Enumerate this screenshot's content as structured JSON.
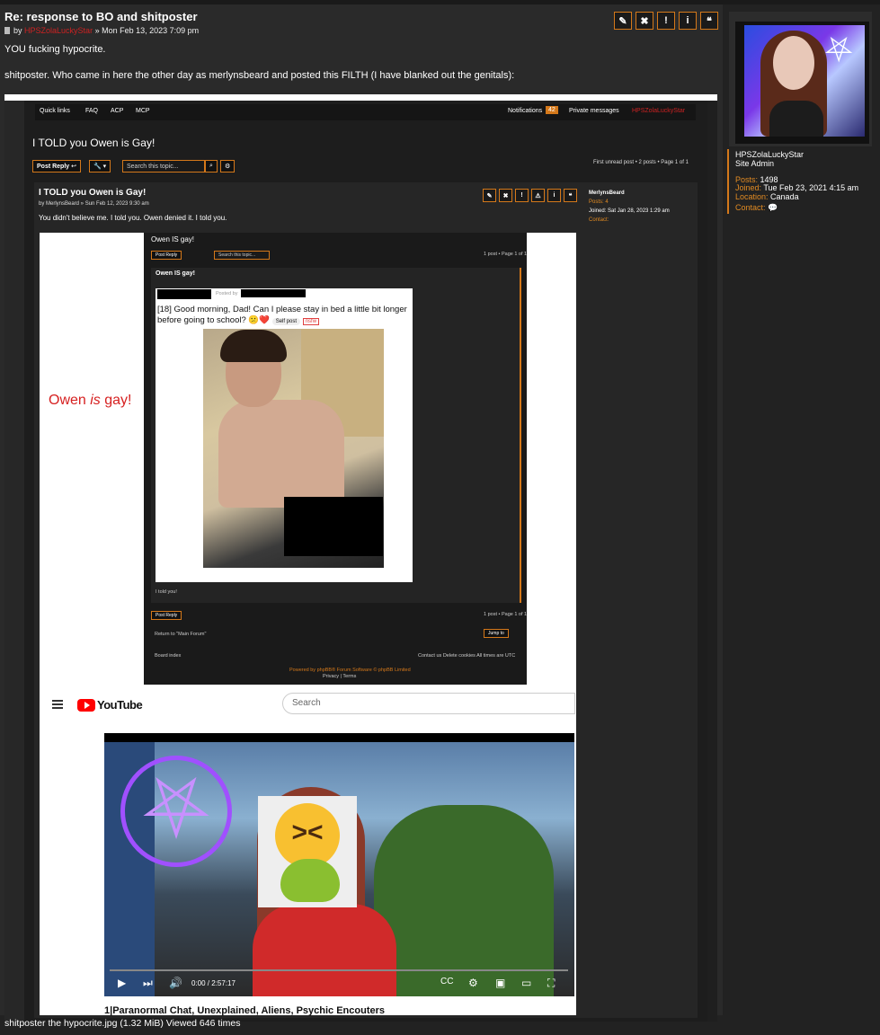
{
  "post": {
    "title": "Re: response to BO and shitposter",
    "by": "by",
    "author": "HPSZolaLuckyStar",
    "date": "» Mon Feb 13, 2023 7:09 pm",
    "line1": "YOU fucking hypocrite.",
    "line2": "shitposter. Who came in here the other day as merlynsbeard and posted this FILTH (I have blanked out the genitals):",
    "actions": [
      "✎",
      "✖",
      "!",
      "i",
      "❝"
    ]
  },
  "author_card": {
    "name": "HPSZolaLuckyStar",
    "rank": "Site Admin",
    "posts_label": "Posts:",
    "posts_value": "1498",
    "joined_label": "Joined:",
    "joined_value": "Tue Feb 23, 2021 4:15 am",
    "location_label": "Location:",
    "location_value": "Canada",
    "contact_label": "Contact:"
  },
  "attachment": {
    "quickbar": {
      "quick_links": "Quick links",
      "faq": "FAQ",
      "acp": "ACP",
      "mcp": "MCP",
      "notifications": "Notifications",
      "notif_count": "42",
      "private_messages": "Private messages",
      "user": "HPSZolaLuckyStar"
    },
    "topic_title": "I TOLD you Owen is Gay!",
    "post_reply": "Post Reply",
    "search_placeholder": "Search this topic...",
    "page_info": "First unread post • 2 posts • Page 1 of 1",
    "inner_post": {
      "title": "I TOLD you Owen is Gay!",
      "by": "by MerlynsBeard » Sun Feb 12, 2023 9:30 am",
      "body": "You didn't believe me. I told you. Owen denied it. I told you.",
      "side_name": "MerlynsBeard",
      "side_posts": "Posts: 4",
      "side_joined": "Joined: Sat Jan 28, 2023 1:29 am",
      "side_contact": "Contact:"
    },
    "owen_prefix": "Owen ",
    "owen_is": "is",
    "owen_suffix": " gay!",
    "shot": {
      "title": "Owen IS gay!",
      "post_reply": "Post Reply",
      "search": "Search this topic...",
      "page": "1 post • Page 1 of 1",
      "post_title": "Owen IS gay!",
      "posted_by": "Posted by",
      "reddit_title": "[18] Good morning, Dad! Can I please stay in bed a little bit longer before going to school?",
      "self_post": "Self post",
      "nsfw": "nsfw",
      "told": "I told you!",
      "return": "Return to \"Main Forum\"",
      "jump": "Jump to",
      "board_index": "Board index",
      "footer_right": "Contact us  Delete cookies  All times are UTC",
      "powered": "Powered by phpBB® Forum Software © phpBB Limited",
      "privacy": "Privacy | Terms"
    },
    "youtube": {
      "logo": "YouTube",
      "search_placeholder": "Search",
      "time": "0:00 / 2:57:17",
      "video_title": "1|Paranormal Chat, Unexplained, Aliens, Psychic Encouters"
    }
  },
  "caption": "shitposter the hypocrite.jpg (1.32 MiB) Viewed 646 times"
}
